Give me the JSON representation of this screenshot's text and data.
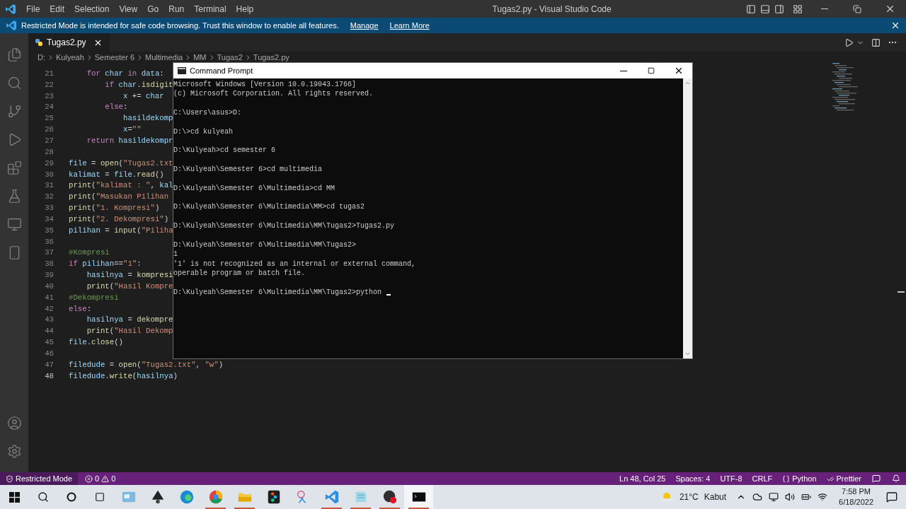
{
  "menu": [
    "File",
    "Edit",
    "Selection",
    "View",
    "Go",
    "Run",
    "Terminal",
    "Help"
  ],
  "window_title": "Tugas2.py - Visual Studio Code",
  "banner": {
    "message": "Restricted Mode is intended for safe code browsing. Trust this window to enable all features.",
    "links": [
      "Manage",
      "Learn More"
    ]
  },
  "tabs": [
    {
      "label": "Tugas2.py",
      "selected": true
    }
  ],
  "breadcrumbs": [
    "D:",
    "Kulyeah",
    "Semester 6",
    "Multimedia",
    "MM",
    "Tugas2",
    "Tugas2.py"
  ],
  "code_lines": [
    {
      "number": "21",
      "current": false,
      "tokens": [
        {
          "text": "    for",
          "kind": "keyword"
        },
        {
          "text": " char",
          "kind": "variable"
        },
        {
          "text": " in",
          "kind": "keyword"
        },
        {
          "text": " data",
          "kind": "variable"
        },
        {
          "text": ":",
          "kind": "plain"
        }
      ]
    },
    {
      "number": "22",
      "current": false,
      "tokens": [
        {
          "text": "        if",
          "kind": "keyword"
        },
        {
          "text": " char",
          "kind": "variable"
        },
        {
          "text": ".",
          "kind": "plain"
        },
        {
          "text": "isdigit",
          "kind": "function"
        }
      ]
    },
    {
      "number": "23",
      "current": false,
      "tokens": [
        {
          "text": "            x",
          "kind": "variable"
        },
        {
          "text": " += ",
          "kind": "plain"
        },
        {
          "text": "char",
          "kind": "variable"
        }
      ]
    },
    {
      "number": "24",
      "current": false,
      "tokens": [
        {
          "text": "        else",
          "kind": "keyword"
        },
        {
          "text": ":",
          "kind": "plain"
        }
      ]
    },
    {
      "number": "25",
      "current": false,
      "tokens": [
        {
          "text": "            hasildekomp",
          "kind": "variable"
        }
      ]
    },
    {
      "number": "26",
      "current": false,
      "tokens": [
        {
          "text": "            x",
          "kind": "variable"
        },
        {
          "text": "=",
          "kind": "plain"
        },
        {
          "text": "\"\"",
          "kind": "string"
        }
      ]
    },
    {
      "number": "27",
      "current": false,
      "tokens": [
        {
          "text": "    return",
          "kind": "keyword"
        },
        {
          "text": " hasildekompr",
          "kind": "variable"
        }
      ]
    },
    {
      "number": "28",
      "current": false
    },
    {
      "number": "29",
      "current": false,
      "tokens": [
        {
          "text": "file",
          "kind": "variable"
        },
        {
          "text": " = ",
          "kind": "plain"
        },
        {
          "text": "open",
          "kind": "function"
        },
        {
          "text": "(",
          "kind": "plain"
        },
        {
          "text": "\"Tugas2.txt",
          "kind": "string"
        }
      ]
    },
    {
      "number": "30",
      "current": false,
      "tokens": [
        {
          "text": "kalimat",
          "kind": "variable"
        },
        {
          "text": " = ",
          "kind": "plain"
        },
        {
          "text": "file",
          "kind": "variable"
        },
        {
          "text": ".",
          "kind": "plain"
        },
        {
          "text": "read",
          "kind": "function"
        },
        {
          "text": "()",
          "kind": "plain"
        }
      ]
    },
    {
      "number": "31",
      "current": false,
      "tokens": [
        {
          "text": "print",
          "kind": "function"
        },
        {
          "text": "(",
          "kind": "plain"
        },
        {
          "text": "\"kalimat : \"",
          "kind": "string"
        },
        {
          "text": ", ",
          "kind": "plain"
        },
        {
          "text": "kal",
          "kind": "variable"
        }
      ]
    },
    {
      "number": "32",
      "current": false,
      "tokens": [
        {
          "text": "print",
          "kind": "function"
        },
        {
          "text": "(",
          "kind": "plain"
        },
        {
          "text": "\"Masukan Pilihan",
          "kind": "string"
        }
      ]
    },
    {
      "number": "33",
      "current": false,
      "tokens": [
        {
          "text": "print",
          "kind": "function"
        },
        {
          "text": "(",
          "kind": "plain"
        },
        {
          "text": "\"1. Kompresi\"",
          "kind": "string"
        },
        {
          "text": ")",
          "kind": "plain"
        }
      ]
    },
    {
      "number": "34",
      "current": false,
      "tokens": [
        {
          "text": "print",
          "kind": "function"
        },
        {
          "text": "(",
          "kind": "plain"
        },
        {
          "text": "\"2. Dekompresi\"",
          "kind": "string"
        },
        {
          "text": ")",
          "kind": "plain"
        }
      ]
    },
    {
      "number": "35",
      "current": false,
      "tokens": [
        {
          "text": "pilihan",
          "kind": "variable"
        },
        {
          "text": " = ",
          "kind": "plain"
        },
        {
          "text": "input",
          "kind": "function"
        },
        {
          "text": "(",
          "kind": "plain"
        },
        {
          "text": "\"Piliha",
          "kind": "string"
        }
      ]
    },
    {
      "number": "36",
      "current": false
    },
    {
      "number": "37",
      "current": false,
      "tokens": [
        {
          "text": "#Kompresi",
          "kind": "comment"
        }
      ]
    },
    {
      "number": "38",
      "current": false,
      "tokens": [
        {
          "text": "if",
          "kind": "keyword"
        },
        {
          "text": " pilihan",
          "kind": "variable"
        },
        {
          "text": "==",
          "kind": "plain"
        },
        {
          "text": "\"1\"",
          "kind": "string"
        },
        {
          "text": ":",
          "kind": "plain"
        }
      ]
    },
    {
      "number": "39",
      "current": false,
      "tokens": [
        {
          "text": "    hasilnya",
          "kind": "variable"
        },
        {
          "text": " = ",
          "kind": "plain"
        },
        {
          "text": "kompresi",
          "kind": "function"
        }
      ]
    },
    {
      "number": "40",
      "current": false,
      "tokens": [
        {
          "text": "    print",
          "kind": "function"
        },
        {
          "text": "(",
          "kind": "plain"
        },
        {
          "text": "\"Hasil Kompre",
          "kind": "string"
        }
      ]
    },
    {
      "number": "41",
      "current": false,
      "tokens": [
        {
          "text": "#Dekompresi",
          "kind": "comment"
        }
      ]
    },
    {
      "number": "42",
      "current": false,
      "tokens": [
        {
          "text": "else",
          "kind": "keyword"
        },
        {
          "text": ":",
          "kind": "plain"
        }
      ]
    },
    {
      "number": "43",
      "current": false,
      "tokens": [
        {
          "text": "    hasilnya",
          "kind": "variable"
        },
        {
          "text": " = ",
          "kind": "plain"
        },
        {
          "text": "dekompre",
          "kind": "function"
        }
      ]
    },
    {
      "number": "44",
      "current": false,
      "tokens": [
        {
          "text": "    print",
          "kind": "function"
        },
        {
          "text": "(",
          "kind": "plain"
        },
        {
          "text": "\"Hasil Dekomp",
          "kind": "string"
        }
      ]
    },
    {
      "number": "45",
      "current": false,
      "tokens": [
        {
          "text": "file",
          "kind": "variable"
        },
        {
          "text": ".",
          "kind": "plain"
        },
        {
          "text": "close",
          "kind": "function"
        },
        {
          "text": "()",
          "kind": "plain"
        }
      ]
    },
    {
      "number": "46",
      "current": false
    },
    {
      "number": "47",
      "current": false,
      "tokens": [
        {
          "text": "filedude",
          "kind": "variable"
        },
        {
          "text": " = ",
          "kind": "plain"
        },
        {
          "text": "open",
          "kind": "function"
        },
        {
          "text": "(",
          "kind": "plain"
        },
        {
          "text": "\"Tugas2.txt\"",
          "kind": "string"
        },
        {
          "text": ", ",
          "kind": "plain"
        },
        {
          "text": "\"w\"",
          "kind": "string"
        },
        {
          "text": ")",
          "kind": "plain"
        }
      ]
    },
    {
      "number": "48",
      "current": true,
      "tokens": [
        {
          "text": "filedude",
          "kind": "variable"
        },
        {
          "text": ".",
          "kind": "plain"
        },
        {
          "text": "write",
          "kind": "function"
        },
        {
          "text": "(",
          "kind": "plain"
        },
        {
          "text": "hasilnya",
          "kind": "variable"
        },
        {
          "text": ")",
          "kind": "plain"
        }
      ]
    }
  ],
  "terminal_window": {
    "title": "Command Prompt",
    "blocks": [
      [
        "Microsoft Windows [Version 10.0.19043.1766]",
        "(c) Microsoft Corporation. All rights reserved."
      ],
      [
        "C:\\Users\\asus>D:"
      ],
      [
        "D:\\>cd kulyeah"
      ],
      [
        "D:\\Kulyeah>cd semester 6"
      ],
      [
        "D:\\Kulyeah\\Semester 6>cd multimedia"
      ],
      [
        "D:\\Kulyeah\\Semester 6\\Multimedia>cd MM"
      ],
      [
        "D:\\Kulyeah\\Semester 6\\Multimedia\\MM>cd tugas2"
      ],
      [
        "D:\\Kulyeah\\Semester 6\\Multimedia\\MM\\Tugas2>Tugas2.py"
      ],
      [
        "D:\\Kulyeah\\Semester 6\\Multimedia\\MM\\Tugas2>",
        "1",
        "'1' is not recognized as an internal or external command,",
        "operable program or batch file."
      ],
      [
        "D:\\Kulyeah\\Semester 6\\Multimedia\\MM\\Tugas2>python"
      ]
    ]
  },
  "status_bar": {
    "mode": "Restricted Mode",
    "errors": "0",
    "warnings": "0",
    "items": [
      {
        "kind": "text",
        "label": "Ln 48, Col 25"
      },
      {
        "kind": "text",
        "label": "Spaces: 4"
      },
      {
        "kind": "text",
        "label": "UTF-8"
      },
      {
        "kind": "text",
        "label": "CRLF"
      },
      {
        "kind": "language",
        "label": "Python"
      },
      {
        "kind": "formatter",
        "label": "Prettier"
      }
    ]
  },
  "taskbar": {
    "apps": [
      {
        "running": false,
        "selected": false
      },
      {
        "running": false,
        "selected": false
      },
      {
        "running": false,
        "selected": false
      },
      {
        "running": true,
        "selected": false
      },
      {
        "running": true,
        "selected": false
      },
      {
        "running": false,
        "selected": false
      },
      {
        "running": false,
        "selected": false
      },
      {
        "running": true,
        "selected": false
      },
      {
        "running": true,
        "selected": false
      },
      {
        "running": true,
        "selected": false
      },
      {
        "running": true,
        "selected": true
      }
    ],
    "temperature": "21°C",
    "weather": "Kabut",
    "time": "7:58 PM",
    "date": "6/18/2022"
  }
}
